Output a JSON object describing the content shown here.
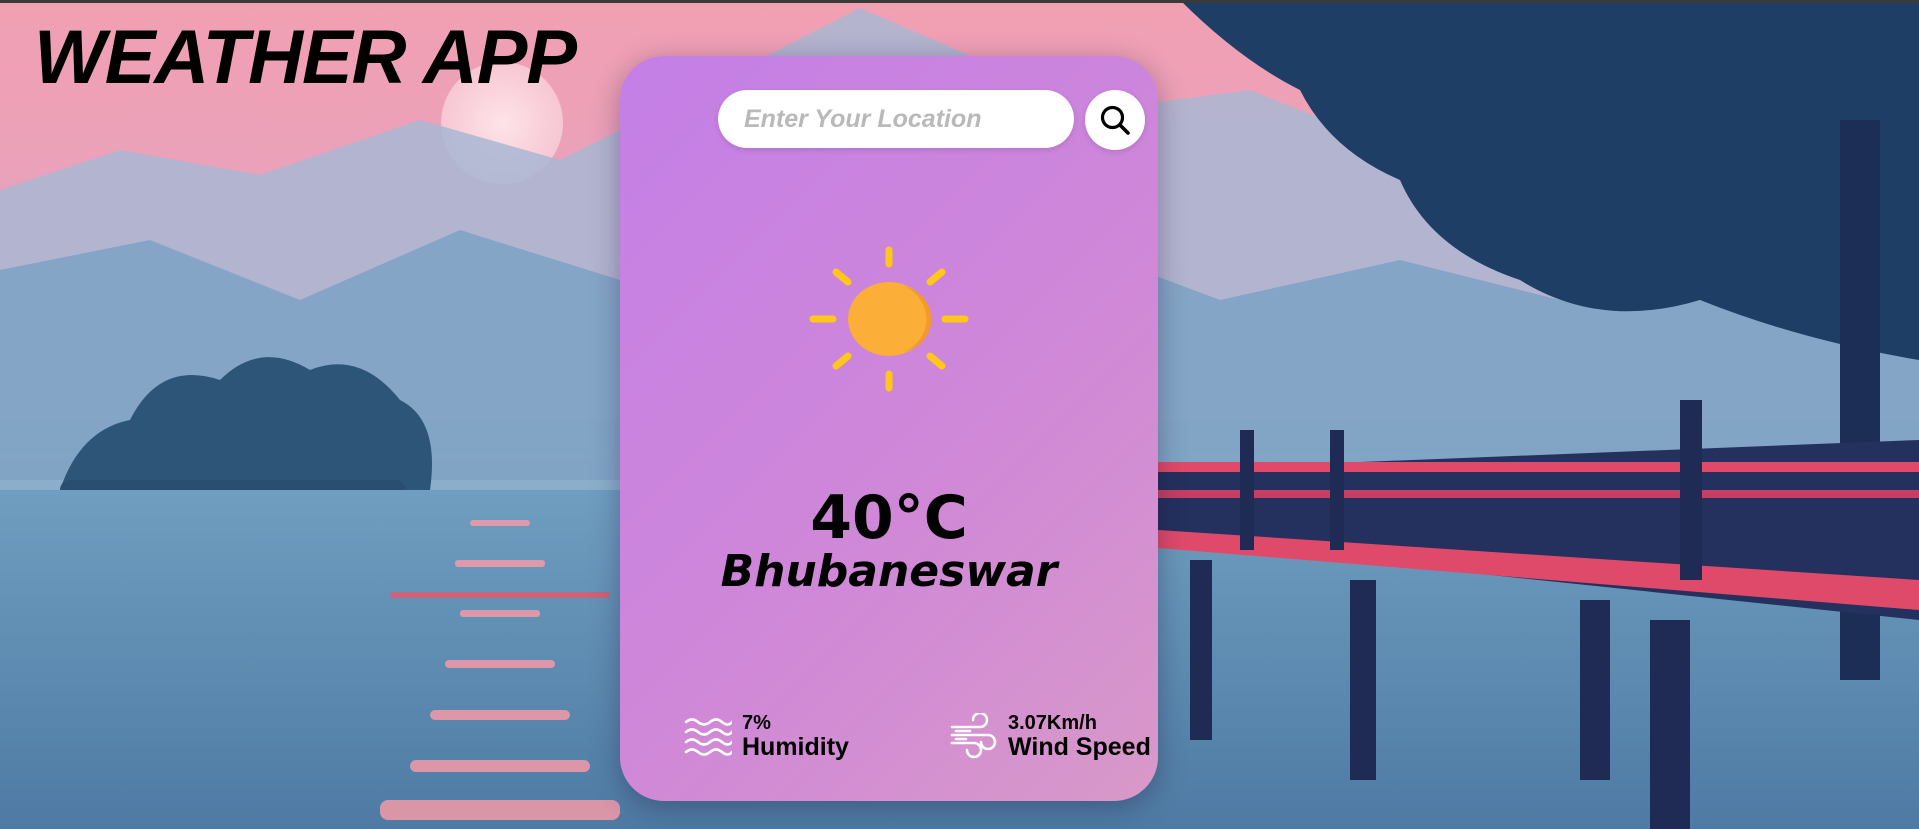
{
  "app": {
    "title": "WEATHER APP"
  },
  "search": {
    "placeholder": "Enter Your Location",
    "value": "",
    "button_icon": "search-icon"
  },
  "weather": {
    "condition_icon": "sun-icon",
    "temperature": "40°C",
    "city": "Bhubaneswar"
  },
  "details": {
    "humidity": {
      "icon": "humidity-waves-icon",
      "value": "7%",
      "label": "Humidity"
    },
    "wind": {
      "icon": "wind-icon",
      "value": "3.07Km/h",
      "label": "Wind Speed"
    }
  },
  "colors": {
    "card_gradient_start": "#c47fe7",
    "card_gradient_end": "#d899c8",
    "sun": "#fbae38",
    "sun_rays": "#ffc719"
  }
}
